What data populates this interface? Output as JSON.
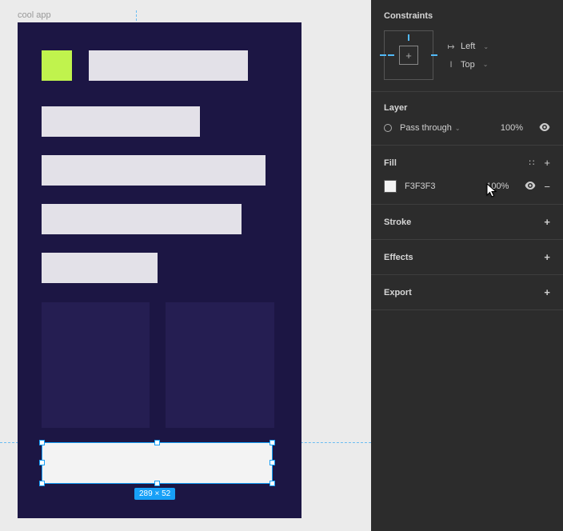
{
  "frame": {
    "label": "cool app",
    "selection_size": "289 × 52"
  },
  "panel": {
    "constraints": {
      "title": "Constraints",
      "horizontal": "Left",
      "vertical": "Top"
    },
    "layer": {
      "title": "Layer",
      "blend_mode": "Pass through",
      "opacity": "100%"
    },
    "fill": {
      "title": "Fill",
      "hex": "F3F3F3",
      "opacity": "100%"
    },
    "stroke": {
      "title": "Stroke"
    },
    "effects": {
      "title": "Effects"
    },
    "export": {
      "title": "Export"
    }
  }
}
